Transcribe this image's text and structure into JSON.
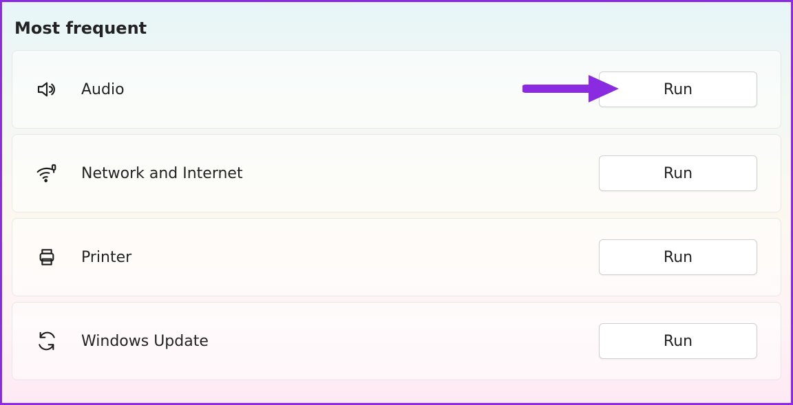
{
  "section": {
    "title": "Most frequent"
  },
  "items": [
    {
      "id": "audio",
      "label": "Audio",
      "icon": "speaker-icon",
      "button": "Run"
    },
    {
      "id": "network",
      "label": "Network and Internet",
      "icon": "wifi-icon",
      "button": "Run"
    },
    {
      "id": "printer",
      "label": "Printer",
      "icon": "printer-icon",
      "button": "Run"
    },
    {
      "id": "windows-update",
      "label": "Windows Update",
      "icon": "sync-icon",
      "button": "Run"
    }
  ],
  "annotation": {
    "arrow_color": "#8a2be2",
    "points_to": "items.0.button"
  }
}
